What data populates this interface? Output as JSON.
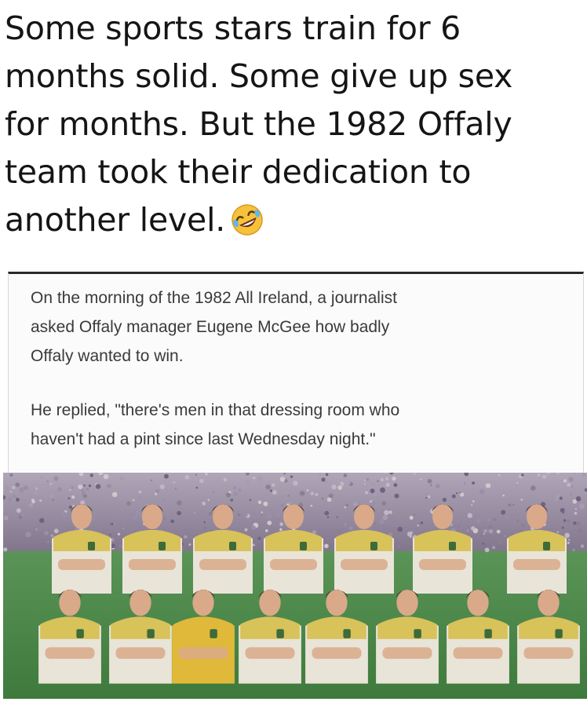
{
  "post": {
    "caption_lines": [
      "Some sports stars train for 6",
      "months solid. Some give up sex",
      "for months. But the 1982 Offaly",
      "team took their dedication to",
      "another level."
    ],
    "emoji_icon": "rolling-on-floor-laughing-emoji"
  },
  "card": {
    "paragraph1_lines": [
      "On the morning of the 1982 All Ireland, a journalist",
      "asked Offaly manager Eugene McGee how badly",
      "Offaly wanted to win."
    ],
    "paragraph2_lines": [
      "He replied, \"there's men in that dressing room who",
      "haven't had a pint since last Wednesday night.\""
    ]
  },
  "photo": {
    "subject": "team-photo",
    "colors": {
      "grass": "#4e8a4a",
      "crowd": "#8a7f9a",
      "jersey": "#e9e4d8",
      "yoke": "#d8c25a",
      "keeper": "#e0b93a"
    }
  }
}
